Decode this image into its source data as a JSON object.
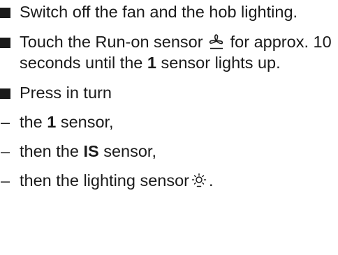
{
  "instructions": {
    "item1": "Switch off the fan and the hob lighting.",
    "item2_before": "Touch the Run-on sensor",
    "item2_icon": "fan-run-on-icon",
    "item2_mid": "for approx. 10 seconds until the",
    "item2_bold": "1",
    "item2_after": "sensor lights up.",
    "item3": "Press in turn",
    "step1_dash": "–",
    "step1_before": "the",
    "step1_bold": "1",
    "step1_after": "sensor,",
    "step2_dash": "–",
    "step2_before": "then the",
    "step2_bold": "IS",
    "step2_after": "sensor,",
    "step3_dash": "–",
    "step3_before": "then the lighting sensor",
    "step3_icon": "lighting-sun-icon",
    "step3_after": "."
  }
}
